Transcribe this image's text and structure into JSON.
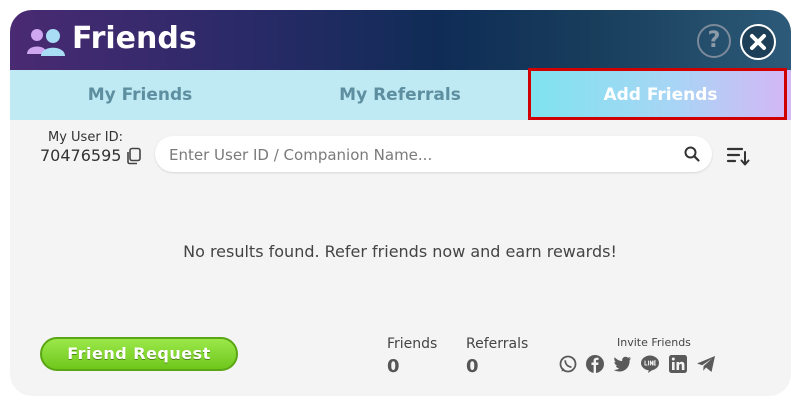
{
  "header": {
    "title": "Friends",
    "icon": "friends-icon",
    "help_label": "?",
    "close_icon": "close-icon"
  },
  "tabs": [
    {
      "label": "My Friends",
      "active": false
    },
    {
      "label": "My Referrals",
      "active": false
    },
    {
      "label": "Add Friends",
      "active": true
    }
  ],
  "user": {
    "id_label": "My User ID:",
    "id_value": "70476595"
  },
  "search": {
    "placeholder": "Enter User ID / Companion Name...",
    "value": ""
  },
  "empty_message": "No results found. Refer friends now and earn rewards!",
  "footer": {
    "friend_request_label": "Friend Request",
    "friends_label": "Friends",
    "friends_count": "0",
    "referrals_label": "Referrals",
    "referrals_count": "0",
    "invite_label": "Invite Friends",
    "social_icons": [
      "whatsapp-icon",
      "facebook-icon",
      "twitter-icon",
      "line-icon",
      "linkedin-icon",
      "telegram-icon"
    ]
  },
  "colors": {
    "accent_green": "#7ed321",
    "highlight_red": "#d10000",
    "tab_bg": "#bfe9f3"
  }
}
